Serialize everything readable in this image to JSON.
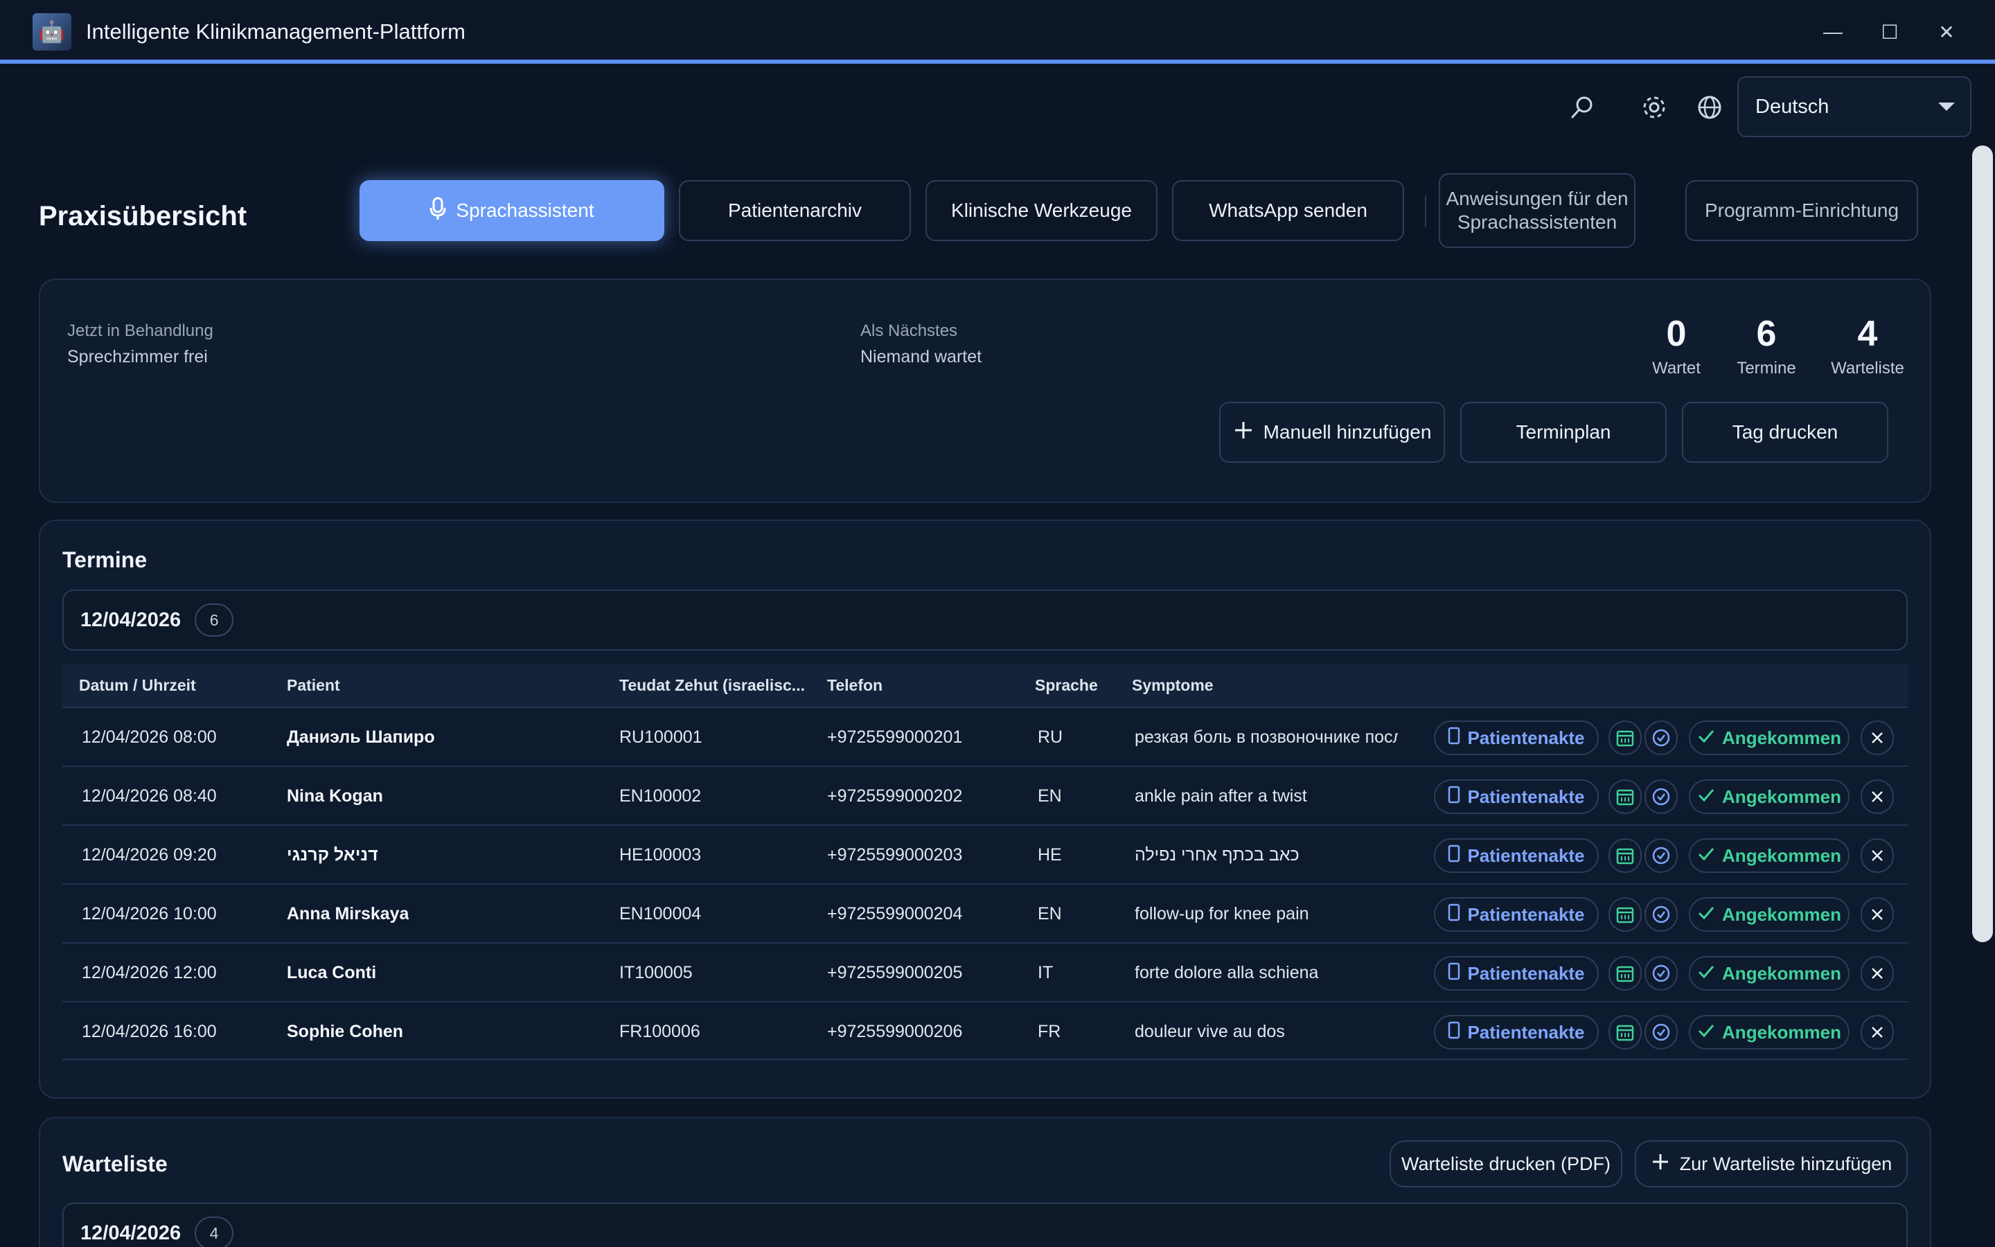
{
  "window": {
    "title": "Intelligente Klinikmanagement-Plattform",
    "minimize_glyph": "—",
    "maximize_glyph": "☐",
    "close_glyph": "✕"
  },
  "toolbar": {
    "language_selected": "Deutsch",
    "icons": [
      "search-icon",
      "gear-icon",
      "globe-icon"
    ]
  },
  "page": {
    "title": "Praxisübersicht"
  },
  "nav": {
    "voice_assistant": "Sprachassistent",
    "patient_archive": "Patientenarchiv",
    "clinical_tools": "Klinische Werkzeuge",
    "whatsapp": "WhatsApp senden",
    "instructions": "Anweisungen für den Sprachassistenten",
    "setup": "Programm-Einrichtung"
  },
  "status": {
    "now_label": "Jetzt in Behandlung",
    "now_value": "Sprechzimmer frei",
    "next_label": "Als Nächstes",
    "next_value": "Niemand wartet",
    "stats": [
      {
        "value": "0",
        "label": "Wartet"
      },
      {
        "value": "6",
        "label": "Termine"
      },
      {
        "value": "4",
        "label": "Warteliste"
      }
    ],
    "add_manual": "Manuell hinzufügen",
    "schedule": "Terminplan",
    "print_day": "Tag drucken"
  },
  "appointments": {
    "title": "Termine",
    "date": "12/04/2026",
    "count": "6",
    "columns": [
      "Datum / Uhrzeit",
      "Patient",
      "Teudat Zehut (israelisc...",
      "Telefon",
      "Sprache",
      "Symptome"
    ],
    "record_label": "Patientenakte",
    "arrived_label": "Angekommen",
    "rows": [
      {
        "datetime": "12/04/2026 08:00",
        "patient": "Даниэль Шапиро",
        "id": "RU100001",
        "phone": "+9725599000201",
        "lang": "RU",
        "symptoms": "резкая боль в позвоночнике после"
      },
      {
        "datetime": "12/04/2026 08:40",
        "patient": "Nina Kogan",
        "id": "EN100002",
        "phone": "+9725599000202",
        "lang": "EN",
        "symptoms": "ankle pain after a twist"
      },
      {
        "datetime": "12/04/2026 09:20",
        "patient": "דניאל קרנגי",
        "id": "HE100003",
        "phone": "+9725599000203",
        "lang": "HE",
        "symptoms": "כאב בכתף אחרי נפילה"
      },
      {
        "datetime": "12/04/2026 10:00",
        "patient": "Anna Mirskaya",
        "id": "EN100004",
        "phone": "+9725599000204",
        "lang": "EN",
        "symptoms": "follow-up for knee pain"
      },
      {
        "datetime": "12/04/2026 12:00",
        "patient": "Luca Conti",
        "id": "IT100005",
        "phone": "+9725599000205",
        "lang": "IT",
        "symptoms": "forte dolore alla schiena"
      },
      {
        "datetime": "12/04/2026 16:00",
        "patient": "Sophie Cohen",
        "id": "FR100006",
        "phone": "+9725599000206",
        "lang": "FR",
        "symptoms": "douleur vive au dos"
      }
    ]
  },
  "waitlist": {
    "title": "Warteliste",
    "print_pdf": "Warteliste drucken (PDF)",
    "add": "Zur Warteliste hinzufügen",
    "date": "12/04/2026",
    "count": "4"
  },
  "colors": {
    "accent": "#6b9bf7",
    "background": "#0b1526",
    "panel": "#0f1c30",
    "record_blue": "#7ea5ff",
    "arrived_green": "#3fd19a"
  }
}
